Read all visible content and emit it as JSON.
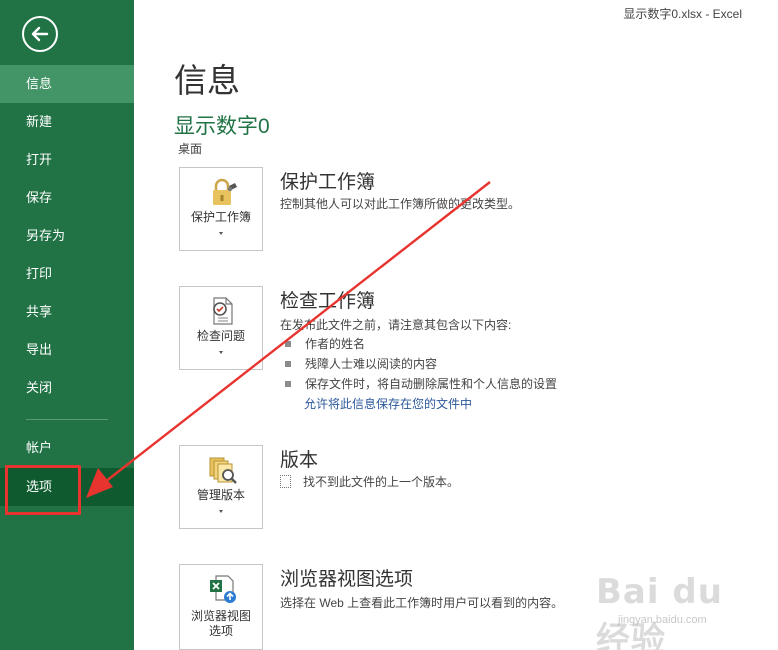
{
  "window": {
    "title": "显示数字0.xlsx - Excel"
  },
  "sidebar": {
    "back_icon": "back-arrow-icon",
    "items": [
      {
        "label": "信息",
        "name": "info"
      },
      {
        "label": "新建",
        "name": "new"
      },
      {
        "label": "打开",
        "name": "open"
      },
      {
        "label": "保存",
        "name": "save"
      },
      {
        "label": "另存为",
        "name": "save-as"
      },
      {
        "label": "打印",
        "name": "print"
      },
      {
        "label": "共享",
        "name": "share"
      },
      {
        "label": "导出",
        "name": "export"
      },
      {
        "label": "关闭",
        "name": "close"
      },
      {
        "label": "帐户",
        "name": "account"
      },
      {
        "label": "选项",
        "name": "options"
      }
    ],
    "active": "信息",
    "highlighted": "选项"
  },
  "main": {
    "title": "信息",
    "doc_name": "显示数字0",
    "doc_location": "桌面",
    "sections": {
      "protect": {
        "button_label": "保护工作簿",
        "icon": "lock-icon",
        "title": "保护工作簿",
        "description": "控制其他人可以对此工作簿所做的更改类型。"
      },
      "inspect": {
        "button_label": "检查问题",
        "icon": "inspect-document-icon",
        "title": "检查工作簿",
        "description": "在发布此文件之前，请注意其包含以下内容:",
        "bullets": [
          "作者的姓名",
          "残障人士难以阅读的内容",
          "保存文件时，将自动删除属性和个人信息的设置"
        ],
        "link": "允许将此信息保存在您的文件中"
      },
      "versions": {
        "button_label": "管理版本",
        "icon": "manage-versions-icon",
        "title": "版本",
        "description": "找不到此文件的上一个版本。"
      },
      "browser": {
        "button_label_1": "浏览器视图",
        "button_label_2": "选项",
        "icon": "excel-web-icon",
        "title": "浏览器视图选项",
        "description": "选择在 Web 上查看此工作簿时用户可以看到的内容。"
      }
    }
  },
  "colors": {
    "sidebar": "#217346",
    "sidebar_active": "#439467",
    "accent_text": "#217346",
    "annotation_red": "#e8342f",
    "link": "#2b579a"
  },
  "watermark": {
    "main": "Bai du 经验",
    "sub": "jingyan.baidu.com"
  }
}
